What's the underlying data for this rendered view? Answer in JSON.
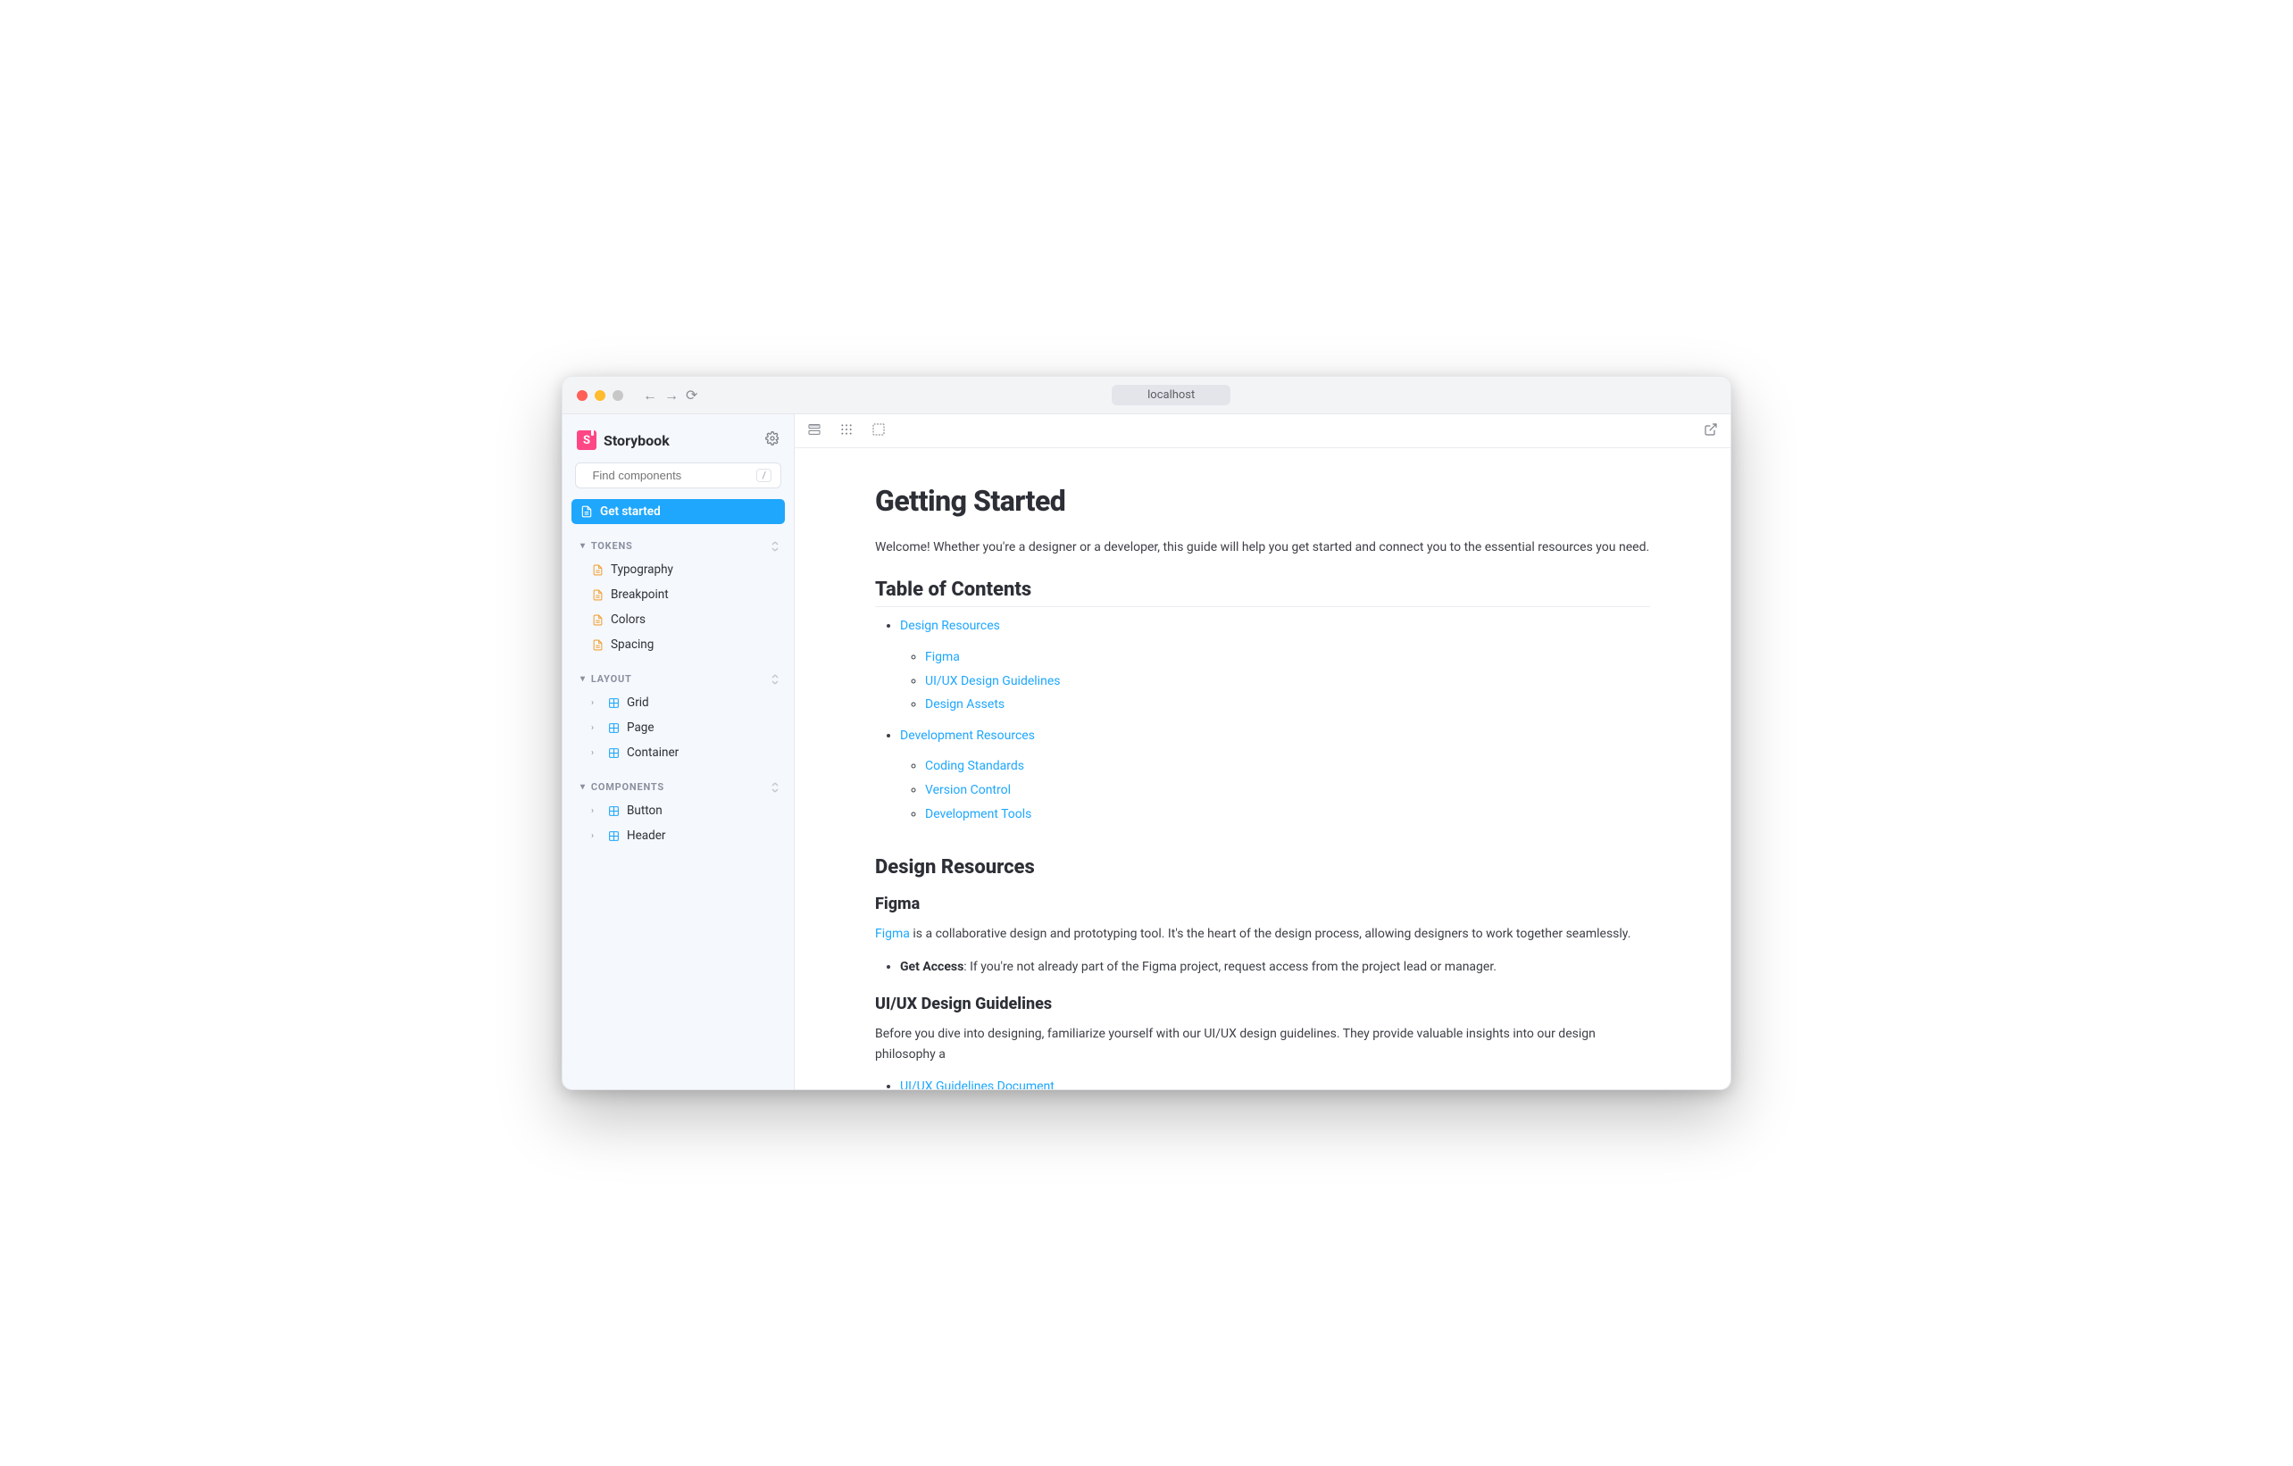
{
  "browser": {
    "address": "localhost"
  },
  "sidebar": {
    "brand": "Storybook",
    "search_placeholder": "Find components",
    "search_hotkey": "/",
    "selected": {
      "label": "Get started"
    },
    "sections": [
      {
        "title": "TOKENS",
        "items": [
          {
            "label": "Typography",
            "kind": "doc"
          },
          {
            "label": "Breakpoint",
            "kind": "doc"
          },
          {
            "label": "Colors",
            "kind": "doc"
          },
          {
            "label": "Spacing",
            "kind": "doc"
          }
        ]
      },
      {
        "title": "LAYOUT",
        "items": [
          {
            "label": "Grid",
            "kind": "component"
          },
          {
            "label": "Page",
            "kind": "component"
          },
          {
            "label": "Container",
            "kind": "component"
          }
        ]
      },
      {
        "title": "COMPONENTS",
        "items": [
          {
            "label": "Button",
            "kind": "component"
          },
          {
            "label": "Header",
            "kind": "component"
          }
        ]
      }
    ]
  },
  "doc": {
    "title": "Getting Started",
    "intro": "Welcome! Whether you're a designer or a developer, this guide will help you get started and connect you to the essential resources you need.",
    "toc_title": "Table of Contents",
    "toc": {
      "design": {
        "label": "Design Resources",
        "items": {
          "figma": "Figma",
          "guidelines": "UI/UX Design Guidelines",
          "assets": "Design Assets"
        }
      },
      "dev": {
        "label": "Development Resources",
        "items": {
          "coding": "Coding Standards",
          "version": "Version Control",
          "tools": "Development Tools"
        }
      }
    },
    "design": {
      "heading": "Design Resources",
      "figma": {
        "heading": "Figma",
        "link": "Figma",
        "text": " is a collaborative design and prototyping tool. It's the heart of the design process, allowing designers to work together seamlessly.",
        "access_label": "Get Access",
        "access_text": ": If you're not already part of the Figma project, request access from the project lead or manager."
      },
      "guidelines": {
        "heading": "UI/UX Design Guidelines",
        "text": "Before you dive into designing, familiarize yourself with our UI/UX design guidelines. They provide valuable insights into our design philosophy a",
        "doc_link": "UI/UX Guidelines Document"
      }
    }
  }
}
